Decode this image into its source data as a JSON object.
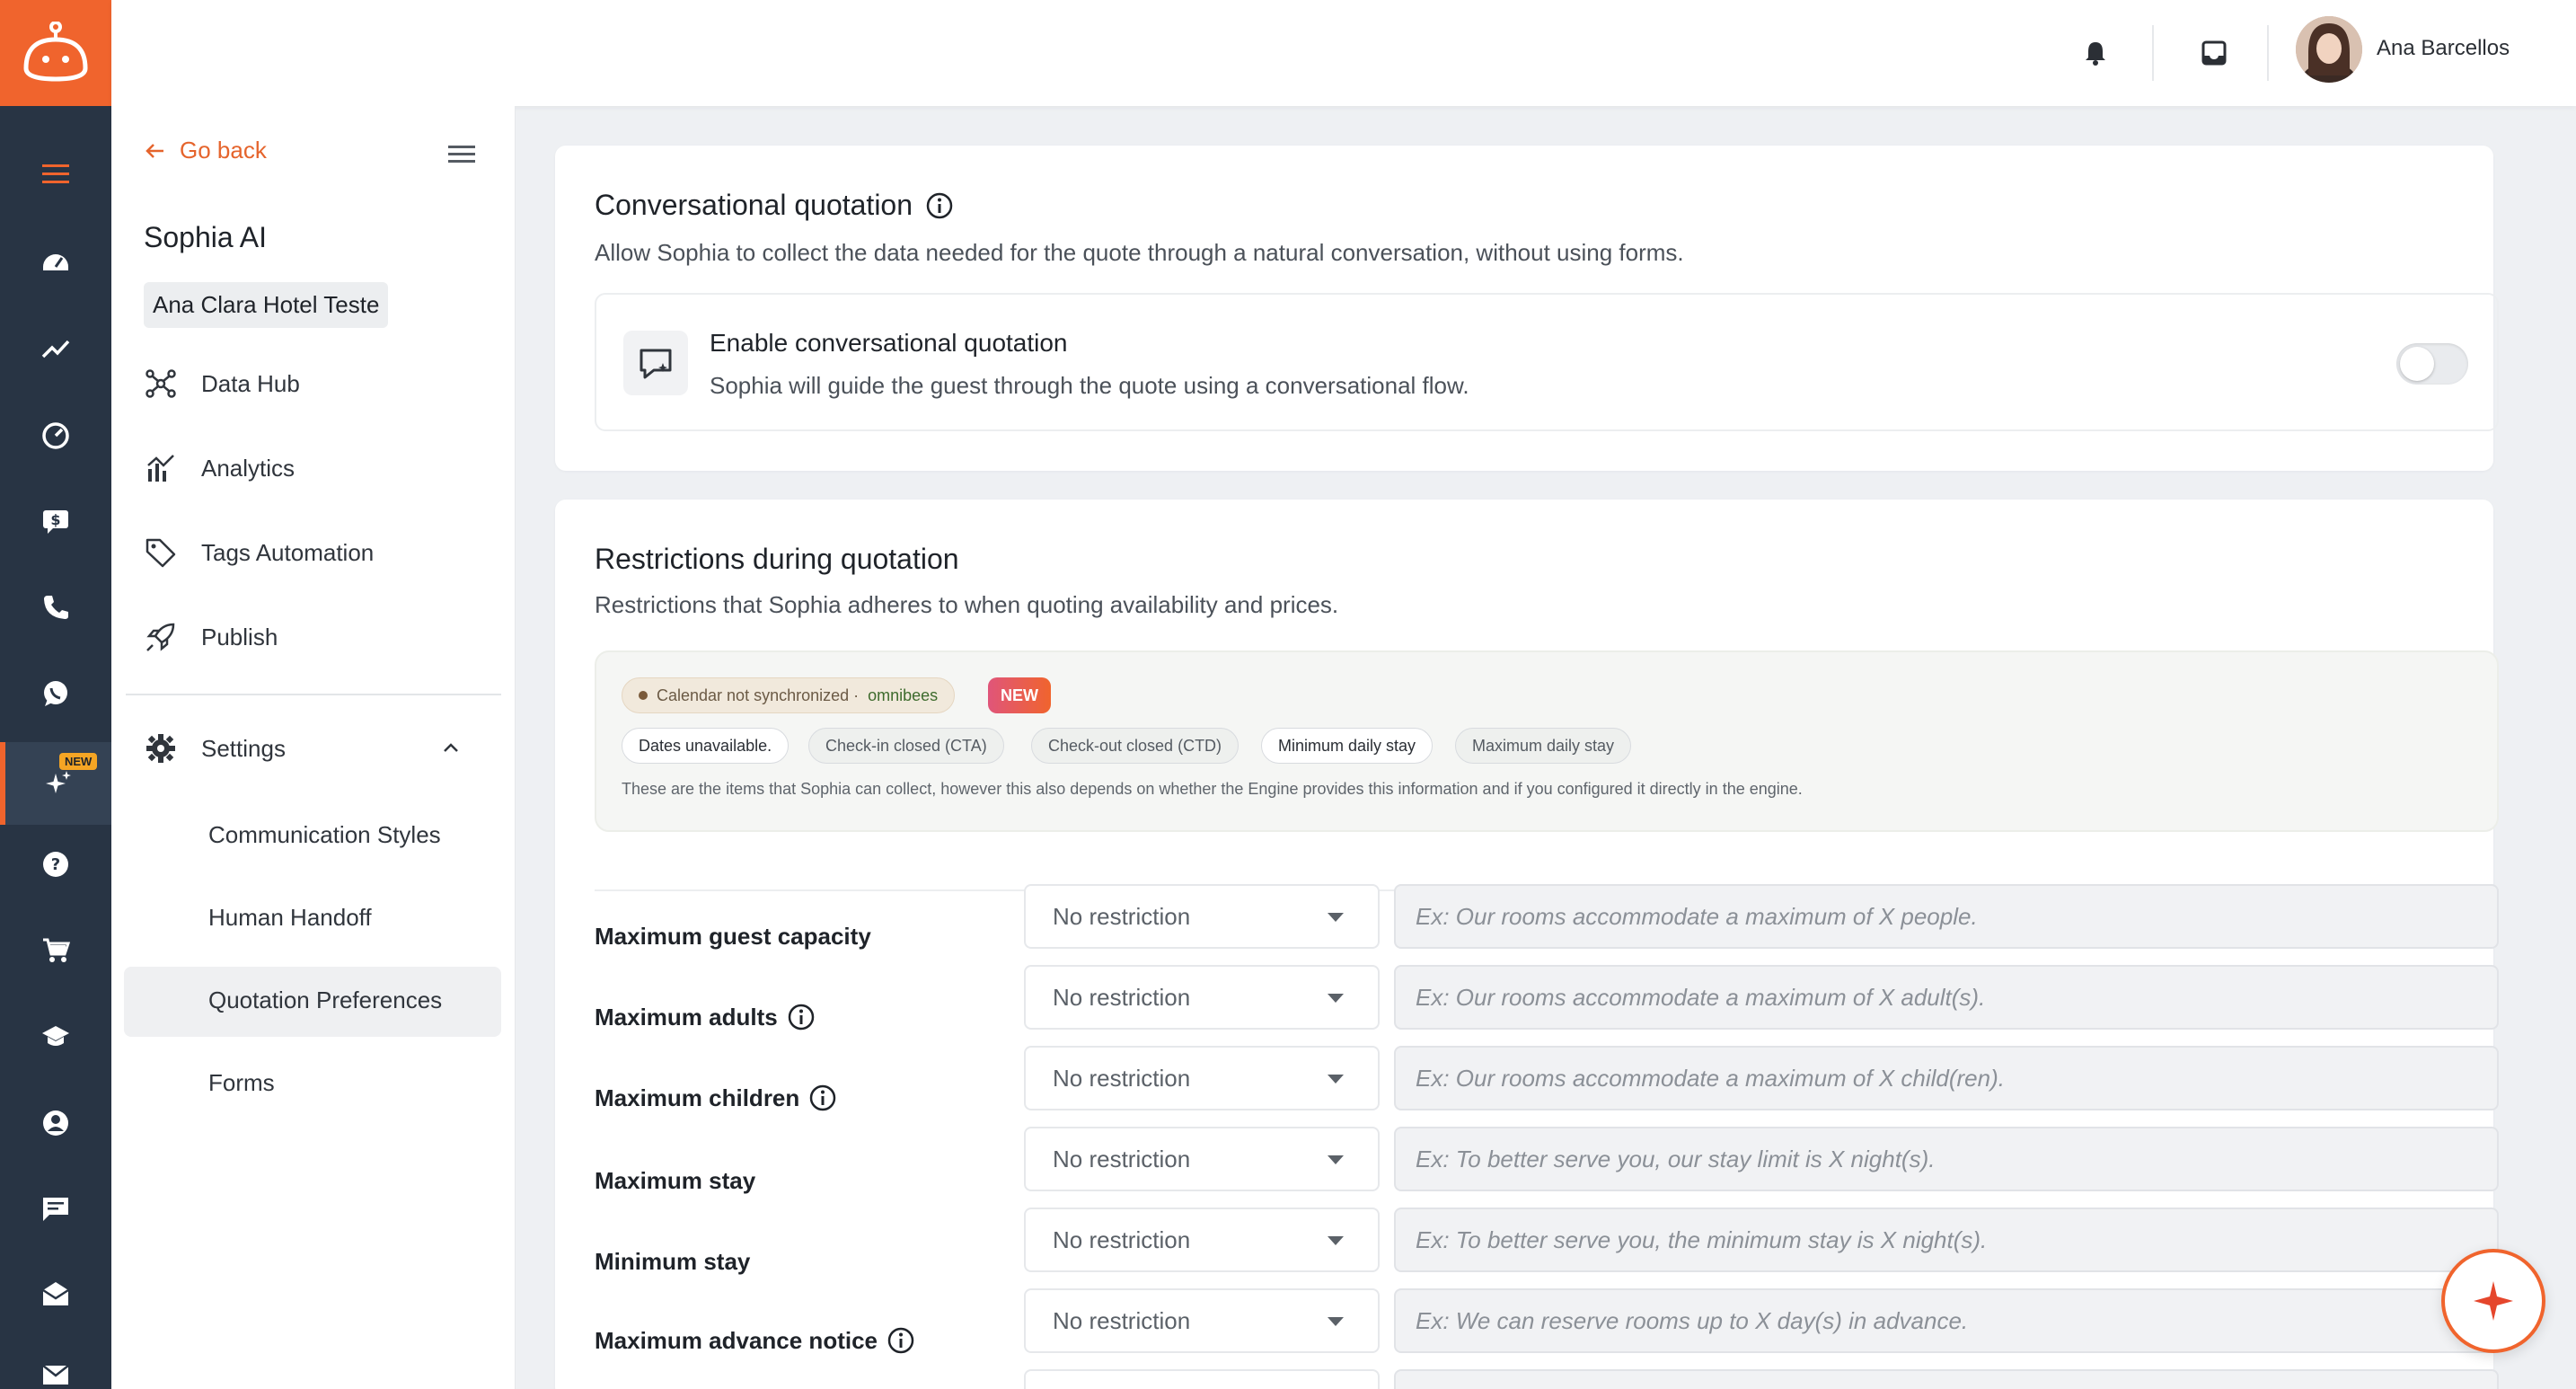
{
  "header": {
    "user_name": "Ana Barcellos",
    "icons": [
      "bell-icon",
      "inbox-icon",
      "chevron-down-icon"
    ]
  },
  "rail": {
    "items": [
      "menu",
      "dashboard",
      "trending",
      "speedometer",
      "sales",
      "phone",
      "whatsapp",
      "sophia-ai",
      "help",
      "cart",
      "school",
      "account",
      "chat",
      "mail-open",
      "mail"
    ],
    "badge": "NEW",
    "accent": "#f0642d"
  },
  "sidebar": {
    "go_back": "Go back",
    "title": "Sophia AI",
    "hotel": "Ana Clara Hotel Teste",
    "items": [
      {
        "label": "Data Hub",
        "icon": "hub-icon"
      },
      {
        "label": "Analytics",
        "icon": "analytics-icon"
      },
      {
        "label": "Tags Automation",
        "icon": "tag-icon"
      },
      {
        "label": "Publish",
        "icon": "rocket-icon"
      }
    ],
    "settings": {
      "label": "Settings",
      "expanded": true,
      "children": [
        "Communication Styles",
        "Human Handoff",
        "Quotation Preferences",
        "Forms"
      ],
      "active": "Quotation Preferences"
    }
  },
  "conversational": {
    "title": "Conversational quotation",
    "description": "Allow Sophia to collect the data needed for the quote through a natural conversation, without using forms.",
    "enable_title": "Enable conversational quotation",
    "enable_description": "Sophia will guide the guest through the quote using a conversational flow.",
    "enabled": false
  },
  "restrictions": {
    "title": "Restrictions during quotation",
    "description": "Restrictions that Sophia adheres to when quoting availability and prices.",
    "calendar_status": "Calendar not synchronized ·",
    "calendar_provider": "omnibees",
    "new_badge": "NEW",
    "chips": [
      "Dates unavailable.",
      "Check-in closed (CTA)",
      "Check-out closed (CTD)",
      "Minimum daily stay",
      "Maximum daily stay"
    ],
    "note": "These are the items that Sophia can collect, however this also depends on whether the Engine provides this information and if you configured it directly in the engine.",
    "rows": [
      {
        "label": "Maximum guest capacity",
        "value": "No restriction",
        "placeholder": "Ex: Our rooms accommodate a maximum of X people.",
        "info": false
      },
      {
        "label": "Maximum adults",
        "value": "No restriction",
        "placeholder": "Ex: Our rooms accommodate a maximum of X adult(s).",
        "info": true
      },
      {
        "label": "Maximum children",
        "value": "No restriction",
        "placeholder": "Ex: Our rooms accommodate a maximum of X child(ren).",
        "info": true
      },
      {
        "label": "Maximum stay",
        "value": "No restriction",
        "placeholder": "Ex: To better serve you, our stay limit is X night(s).",
        "info": false
      },
      {
        "label": "Minimum stay",
        "value": "No restriction",
        "placeholder": "Ex: To better serve you, the minimum stay is X night(s).",
        "info": false
      },
      {
        "label": "Maximum advance notice",
        "value": "No restriction",
        "placeholder": "Ex: We can reserve rooms up to X day(s) in advance.",
        "info": true
      }
    ]
  }
}
